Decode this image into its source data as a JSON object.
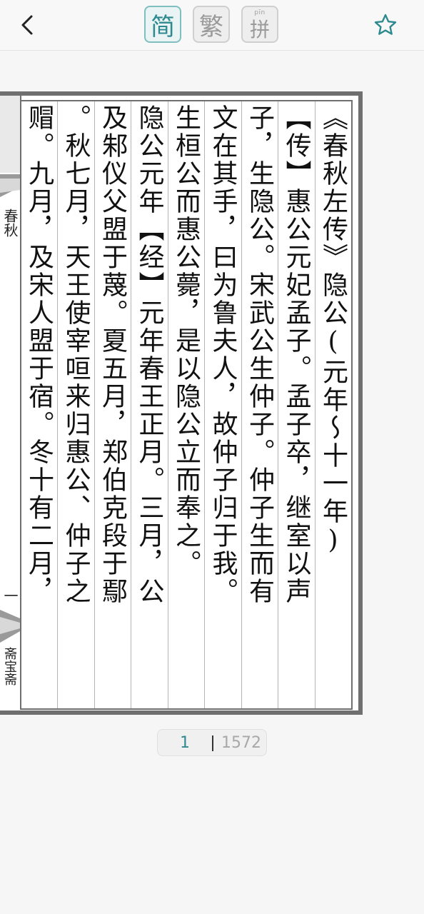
{
  "toolbar": {
    "back_icon": "chevron-left-icon",
    "modes": {
      "simplified": "简",
      "traditional": "繁",
      "pinyin_char": "拼",
      "pinyin_sup": "pīn"
    },
    "active_mode": "simplified",
    "favorite_icon": "star-outline-icon",
    "accent_color": "#2e8a8f"
  },
  "book": {
    "columns": [
      "《春秋左传》隐公(元年～十一年)",
      "子，生隐公。宋武公生仲子。仲子生而有",
      "文在其手，曰为鲁夫人，故仲子归于我。",
      "生桓公而惠公薨，是以隐公立而奉之。",
      "隐公元年【经】元年春王正月。三月，公",
      "及邾仪父盟于蔑。夏五月，郑伯克段于鄢",
      "。秋七月，天王使宰咺来归惠公、仲子之",
      "赗。九月，及宋人盟于宿。冬十有二月，"
    ],
    "inserted_column": "【传】惠公元妃孟子。孟子卒，继室以声",
    "margin": {
      "title": "春秋",
      "page_number": "一",
      "publisher": "斋宝斋"
    }
  },
  "pager": {
    "current": "1",
    "total": "1572"
  }
}
